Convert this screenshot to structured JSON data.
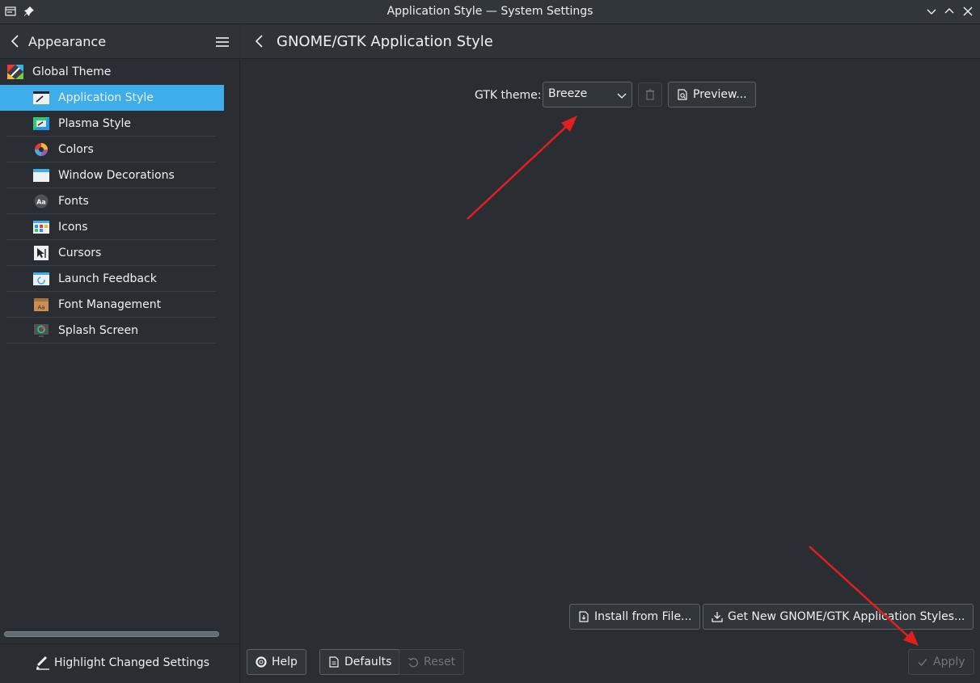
{
  "window": {
    "title": "Application Style — System Settings"
  },
  "sidebar": {
    "header_label": "Appearance",
    "top_item": "Global Theme",
    "items": [
      {
        "label": "Application Style",
        "active": true
      },
      {
        "label": "Plasma Style"
      },
      {
        "label": "Colors"
      },
      {
        "label": "Window Decorations"
      },
      {
        "label": "Fonts"
      },
      {
        "label": "Icons"
      },
      {
        "label": "Cursors"
      },
      {
        "label": "Launch Feedback"
      },
      {
        "label": "Font Management"
      },
      {
        "label": "Splash Screen"
      }
    ],
    "footer_label": "Highlight Changed Settings"
  },
  "main": {
    "title": "GNOME/GTK Application Style",
    "gtk_theme_label": "GTK theme:",
    "gtk_theme_value": "Breeze",
    "preview_label": "Preview...",
    "install_label": "Install from File...",
    "get_new_label": "Get New GNOME/GTK Application Styles..."
  },
  "bottom_bar": {
    "help": "Help",
    "defaults": "Defaults",
    "reset": "Reset",
    "apply": "Apply"
  },
  "colors": {
    "accent": "#3daee9",
    "annotation_arrow": "#e31e1e"
  }
}
